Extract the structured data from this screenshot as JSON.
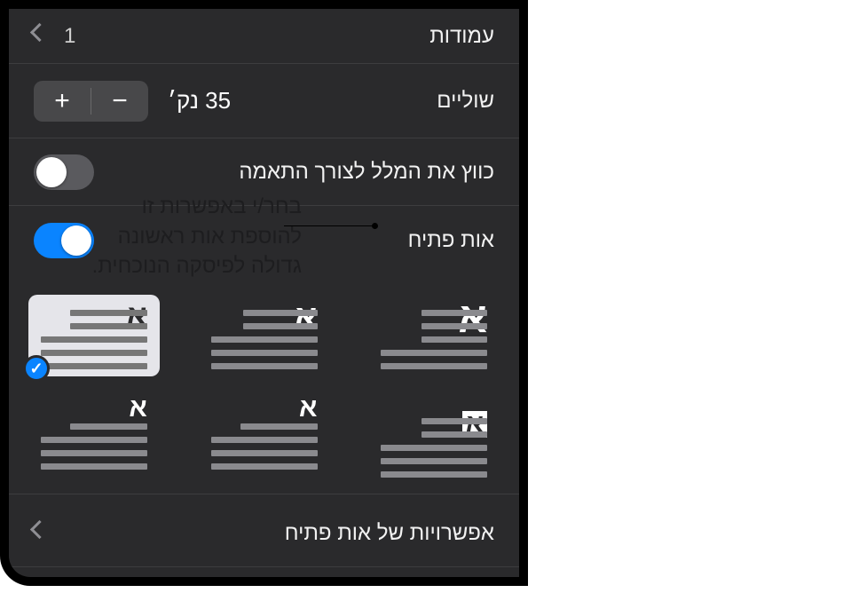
{
  "columns": {
    "label": "עמודות",
    "value": "1"
  },
  "margins": {
    "label": "שוליים",
    "value": "35 נק׳"
  },
  "shrink": {
    "label": "כווץ את המלל לצורך התאמה",
    "on": false
  },
  "dropcap": {
    "label": "אות פתיח",
    "on": true,
    "selected_index": 2,
    "glyph": "א"
  },
  "options_row": {
    "label": "אפשרויות של אות פתיח"
  },
  "callout": {
    "line1": "בחר/י באפשרות זו",
    "line2": "להוספת אות ראשונה",
    "line3": "גדולה לפיסקה הנוכחית."
  }
}
